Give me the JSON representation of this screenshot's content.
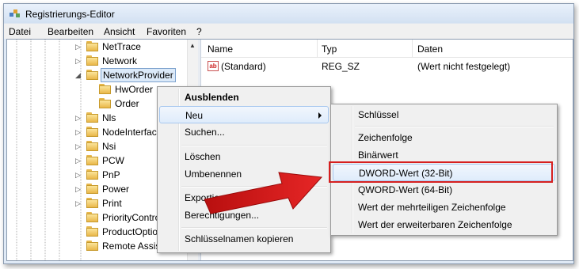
{
  "window": {
    "title": "Registrierungs-Editor"
  },
  "menubar": [
    "Datei",
    "Bearbeiten",
    "Ansicht",
    "Favoriten",
    "?"
  ],
  "tree": {
    "items": [
      {
        "label": "NetTrace",
        "expander": "collapsed"
      },
      {
        "label": "Network",
        "expander": "collapsed"
      },
      {
        "label": "NetworkProvider",
        "expander": "expanded",
        "selected": true
      },
      {
        "label": "HwOrder",
        "expander": "none",
        "child": true
      },
      {
        "label": "Order",
        "expander": "none",
        "child": true
      },
      {
        "label": "Nls",
        "expander": "collapsed"
      },
      {
        "label": "NodeInterface",
        "expander": "collapsed"
      },
      {
        "label": "Nsi",
        "expander": "collapsed"
      },
      {
        "label": "PCW",
        "expander": "collapsed"
      },
      {
        "label": "PnP",
        "expander": "collapsed"
      },
      {
        "label": "Power",
        "expander": "collapsed"
      },
      {
        "label": "Print",
        "expander": "collapsed"
      },
      {
        "label": "PriorityControl",
        "expander": "none"
      },
      {
        "label": "ProductOptions",
        "expander": "none"
      },
      {
        "label": "Remote Assistance",
        "expander": "none"
      }
    ]
  },
  "list": {
    "columns": [
      "Name",
      "Typ",
      "Daten"
    ],
    "rows": [
      {
        "name": "(Standard)",
        "type": "REG_SZ",
        "data": "(Wert nicht festgelegt)",
        "icon": "ab-string-icon"
      }
    ]
  },
  "context_menu": {
    "items": [
      "Ausblenden",
      "Neu",
      "Suchen...",
      "Löschen",
      "Umbenennen",
      "Exportieren",
      "Berechtigungen...",
      "Schlüsselnamen kopieren"
    ]
  },
  "submenu": {
    "items": [
      "Schlüssel",
      "Zeichenfolge",
      "Binärwert",
      "DWORD-Wert (32-Bit)",
      "QWORD-Wert (64-Bit)",
      "Wert der mehrteiligen Zeichenfolge",
      "Wert der erweiterbaren Zeichenfolge"
    ],
    "highlighted": "DWORD-Wert (32-Bit)"
  },
  "colors": {
    "accent_red": "#d62020",
    "selection": "#dceaf9",
    "titlebar": "#d3e1f2"
  }
}
